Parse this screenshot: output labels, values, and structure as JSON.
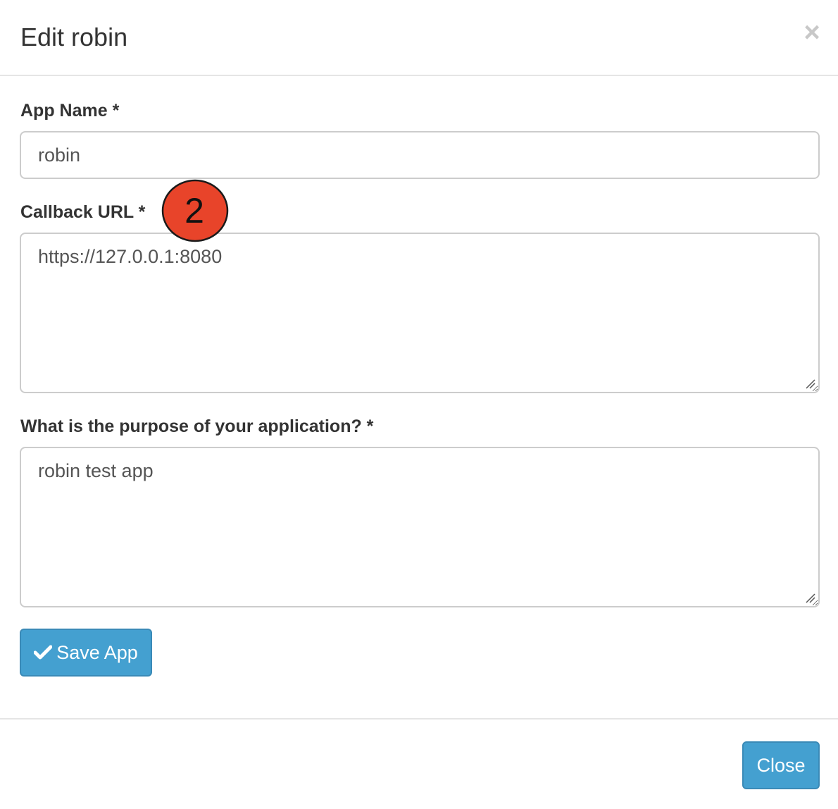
{
  "dialog": {
    "title": "Edit robin",
    "close_icon": "close-icon",
    "close_glyph": "×"
  },
  "form": {
    "app_name": {
      "label": "App Name *",
      "value": "robin"
    },
    "callback_url": {
      "label": "Callback URL *",
      "value": "https://127.0.0.1:8080"
    },
    "purpose": {
      "label": "What is the purpose of your application? *",
      "value": "robin test app"
    },
    "save_button": {
      "label": "Save App",
      "icon": "check-icon"
    }
  },
  "annotation": {
    "step_number": "2",
    "fill_color": "#e8442a"
  },
  "footer": {
    "close_label": "Close"
  },
  "colors": {
    "primary_button": "#44a0d0",
    "primary_button_border": "#3a8ab7",
    "field_border": "#cccccc",
    "divider": "#e5e5e5"
  }
}
